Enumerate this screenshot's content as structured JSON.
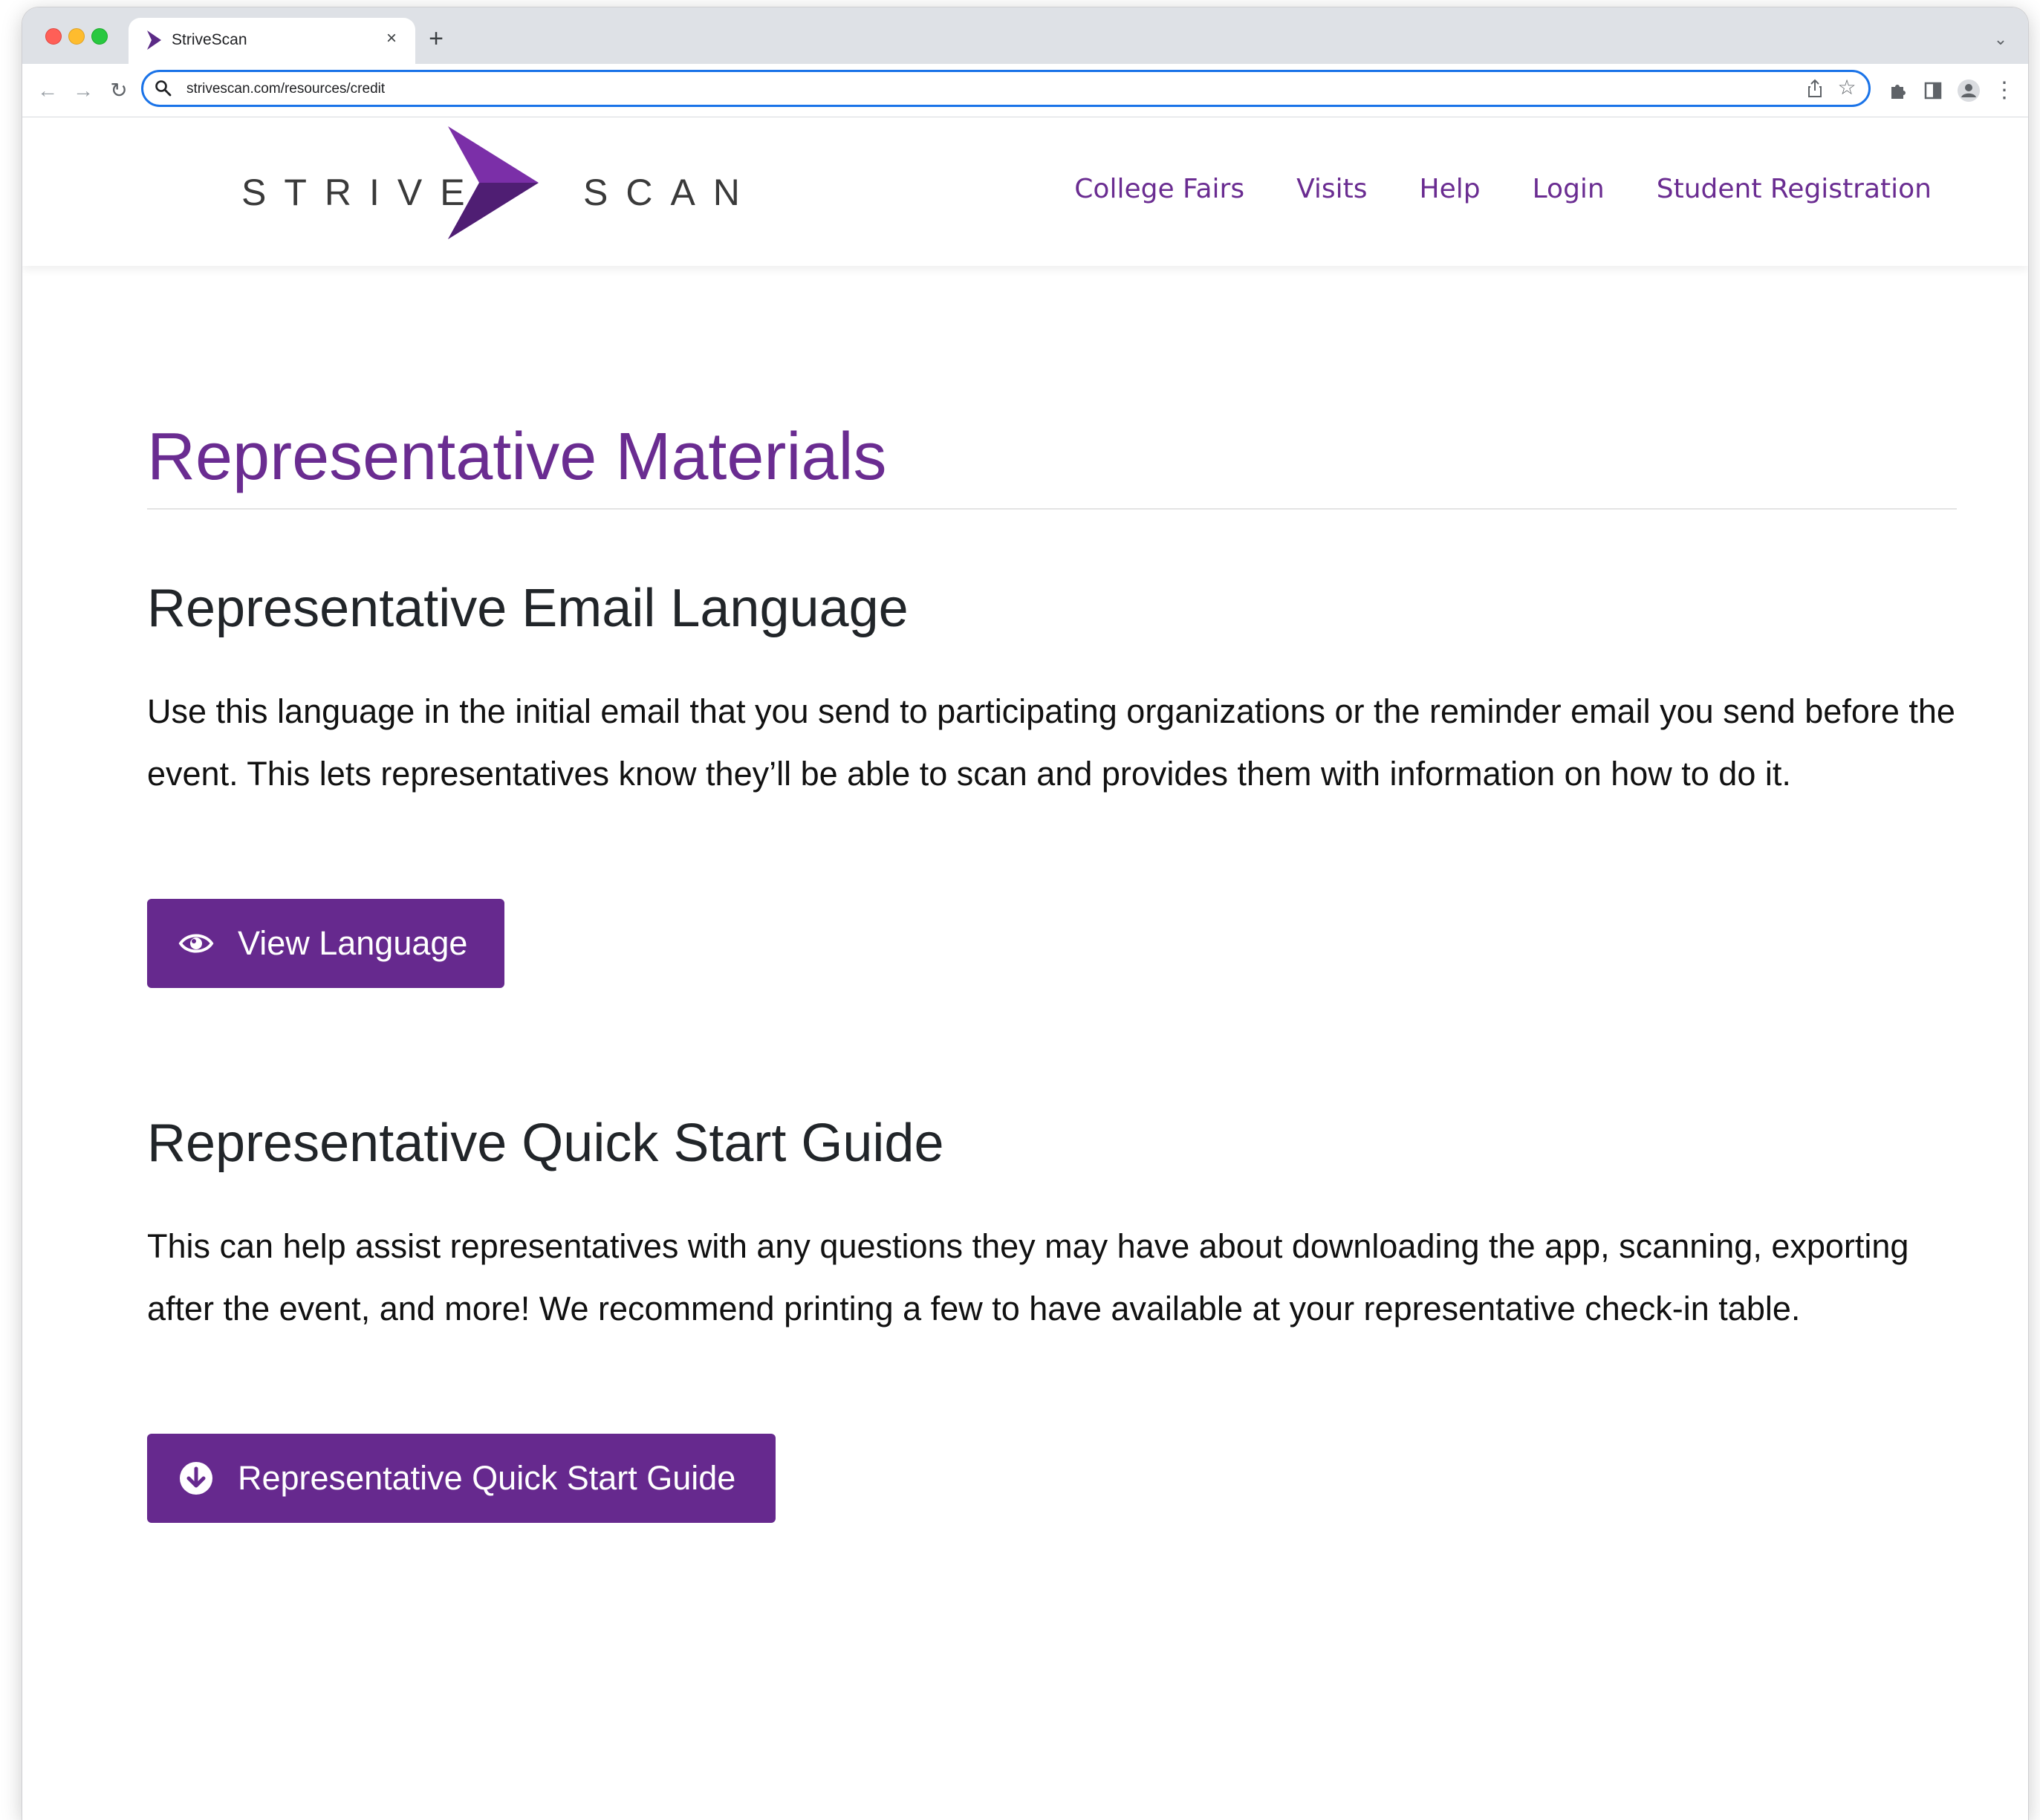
{
  "browser": {
    "tab_title": "StriveScan",
    "tab_close": "×",
    "new_tab": "+",
    "tab_search": "⌄",
    "url": "strivescan.com/resources/credit"
  },
  "site": {
    "logo_left": "STRIVE",
    "logo_right": "SCAN",
    "brand_color": "#6a2c91",
    "nav": [
      "College Fairs",
      "Visits",
      "Help",
      "Login",
      "Student Registration"
    ]
  },
  "page": {
    "title": "Representative Materials",
    "sections": [
      {
        "heading": "Representative Email Language",
        "body": "Use this language in the initial email that you send to participating organizations or the reminder email you send before the event. This lets representatives know they’ll be able to scan and provides them with information on how to do it.",
        "button_label": "View Language",
        "button_icon": "eye-icon"
      },
      {
        "heading": "Representative Quick Start Guide",
        "body": "This can help assist representatives with any questions they may have about downloading the app, scanning, exporting after the event, and more! We recommend printing a few to have available at your representative check-in table.",
        "button_label": "Representative Quick Start Guide",
        "button_icon": "download-circle-icon"
      }
    ]
  }
}
